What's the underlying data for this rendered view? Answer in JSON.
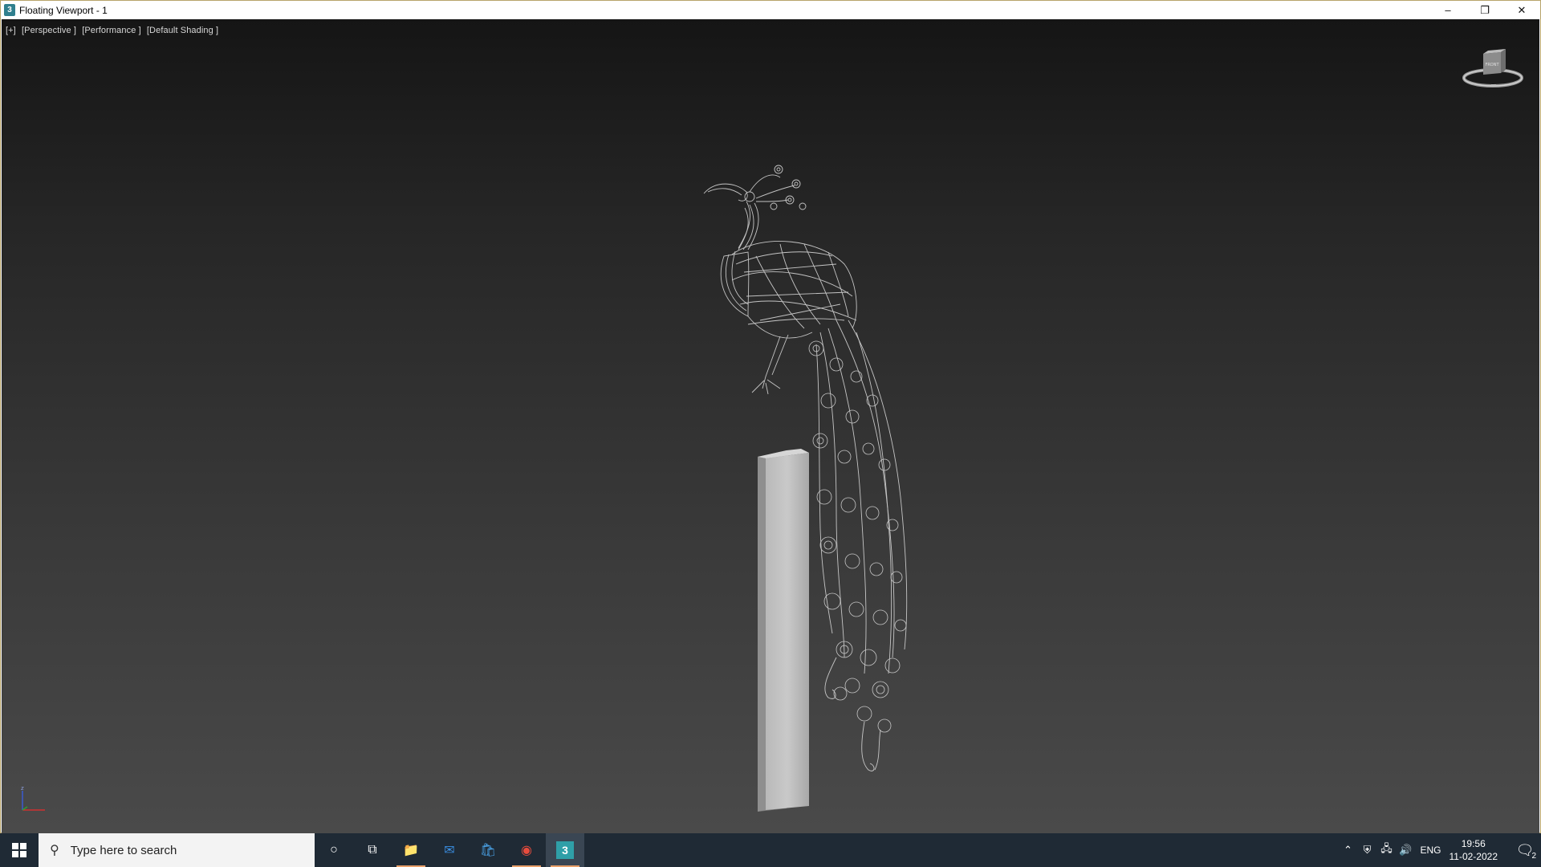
{
  "window": {
    "title": "Floating Viewport - 1",
    "controls": {
      "minimize": "–",
      "restore": "❐",
      "close": "✕"
    }
  },
  "viewport": {
    "labels": [
      "[+]",
      "[Perspective ]",
      "[Performance ]",
      "[Default Shading ]"
    ],
    "viewcube_face": "FRONT",
    "axis_label": "z"
  },
  "taskbar": {
    "search_placeholder": "Type here to search",
    "apps": [
      {
        "name": "cortana-icon",
        "glyph": "○"
      },
      {
        "name": "task-view-icon",
        "glyph": "⧉"
      },
      {
        "name": "file-explorer-icon",
        "glyph": "📁"
      },
      {
        "name": "mail-icon",
        "glyph": "✉"
      },
      {
        "name": "store-icon",
        "glyph": "🛍"
      },
      {
        "name": "chrome-icon",
        "glyph": "◉"
      },
      {
        "name": "3dsmax-icon",
        "glyph": "3"
      }
    ],
    "tray": {
      "lang": "ENG",
      "time": "19:56",
      "date": "11-02-2022",
      "notifications": "2"
    }
  },
  "colors": {
    "taskbar": "#1f2a35",
    "accent_underline": "#e9a06a",
    "window_border": "#b8a46a"
  }
}
